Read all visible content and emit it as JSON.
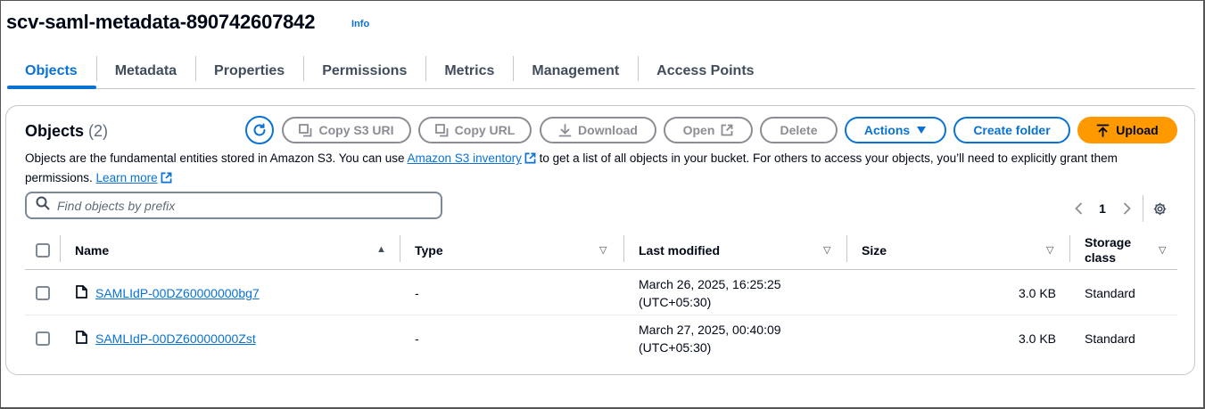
{
  "header": {
    "bucket_name": "scv-saml-metadata-890742607842",
    "info_label": "Info"
  },
  "tabs": [
    {
      "label": "Objects",
      "active": true
    },
    {
      "label": "Metadata"
    },
    {
      "label": "Properties"
    },
    {
      "label": "Permissions"
    },
    {
      "label": "Metrics"
    },
    {
      "label": "Management"
    },
    {
      "label": "Access Points"
    }
  ],
  "objects_panel": {
    "title": "Objects",
    "count": "(2)",
    "description_part1": "Objects are the fundamental entities stored in Amazon S3. You can use ",
    "inventory_link": "Amazon S3 inventory",
    "description_part2": " to get a list of all objects in your bucket. For others to access your objects, you’ll need to explicitly grant them permissions.",
    "learn_more": "Learn more",
    "toolbar": {
      "copy_s3_uri": "Copy S3 URI",
      "copy_url": "Copy URL",
      "download": "Download",
      "open": "Open",
      "delete": "Delete",
      "actions": "Actions",
      "create_folder": "Create folder",
      "upload": "Upload"
    },
    "search": {
      "placeholder": "Find objects by prefix"
    },
    "pagination": {
      "current_page": "1"
    },
    "columns": {
      "name": "Name",
      "type": "Type",
      "last_modified": "Last modified",
      "size": "Size",
      "storage_class_line1": "Storage",
      "storage_class_line2": "class"
    },
    "rows": [
      {
        "name": "SAMLIdP-00DZ60000000bg7",
        "type": "-",
        "modified_date": "March 26, 2025, 16:25:25",
        "modified_tz": "(UTC+05:30)",
        "size": "3.0 KB",
        "storage_class": "Standard"
      },
      {
        "name": "SAMLIdP-00DZ60000000Zst",
        "type": "-",
        "modified_date": "March 27, 2025, 00:40:09",
        "modified_tz": "(UTC+05:30)",
        "size": "3.0 KB",
        "storage_class": "Standard"
      }
    ]
  },
  "colors": {
    "accent": "#0972d3",
    "primary_button": "#ff9900",
    "text": "#000716",
    "disabled": "#8c8c94"
  }
}
